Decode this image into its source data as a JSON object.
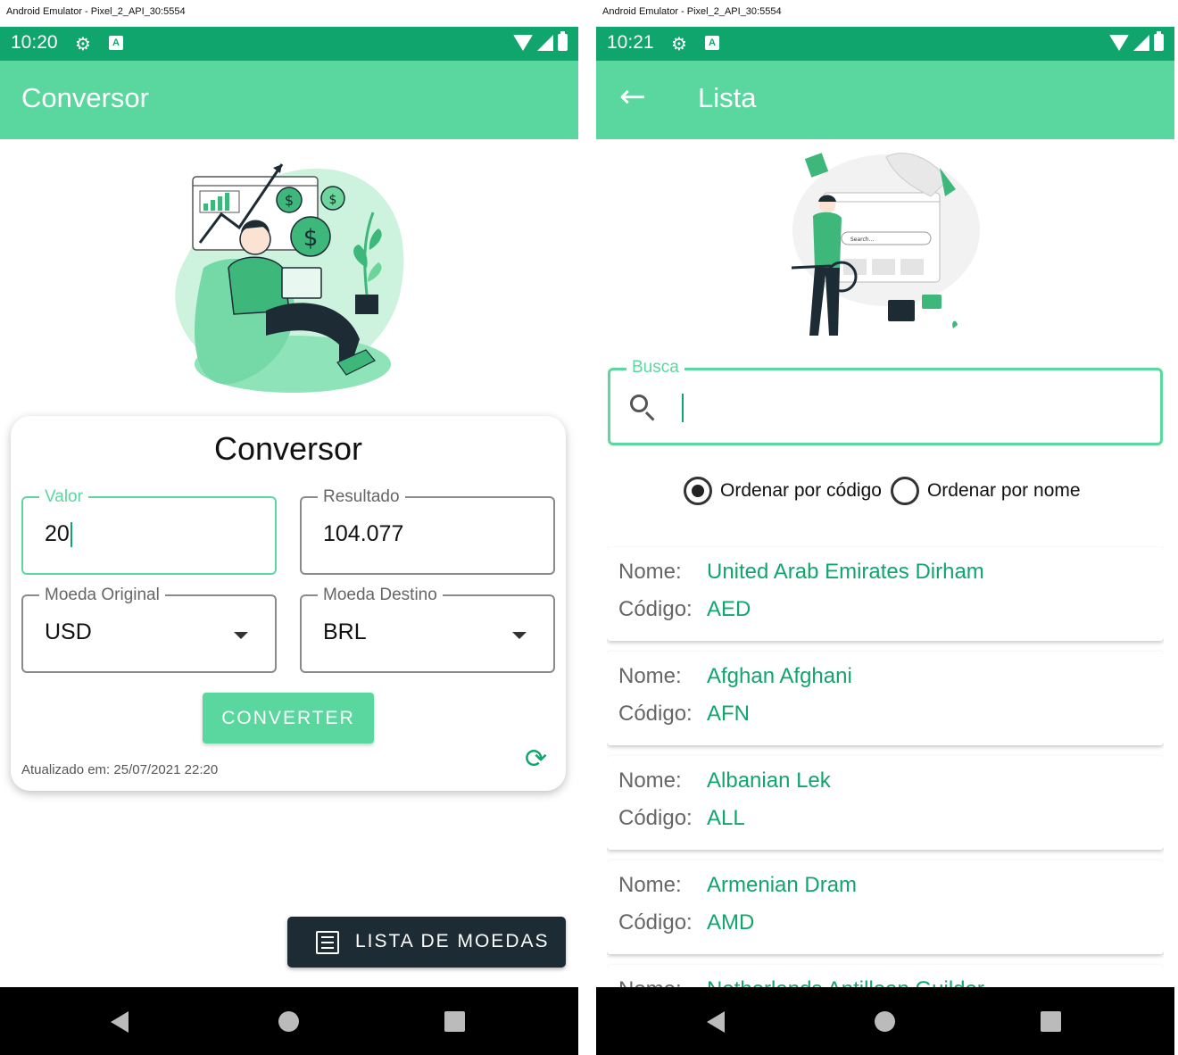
{
  "left": {
    "window_title": "Android Emulator - Pixel_2_API_30:5554",
    "status_time": "10:20",
    "appbar_title": "Conversor",
    "card_title": "Conversor",
    "valor": {
      "label": "Valor",
      "value": "20"
    },
    "resultado": {
      "label": "Resultado",
      "value": "104.077"
    },
    "moeda_original": {
      "label": "Moeda Original",
      "value": "USD"
    },
    "moeda_destino": {
      "label": "Moeda Destino",
      "value": "BRL"
    },
    "convert_label": "CONVERTER",
    "updated_text": "Atualizado em: 25/07/2021 22:20",
    "list_button_label": "LISTA DE MOEDAS"
  },
  "right": {
    "window_title": "Android Emulator - Pixel_2_API_30:5554",
    "status_time": "10:21",
    "appbar_title": "Lista",
    "search_label": "Busca",
    "search_value": "",
    "sort_options": [
      "Ordenar por código",
      "Ordenar por nome"
    ],
    "sort_selected": "Ordenar por código",
    "name_label": "Nome:",
    "code_label": "Código:",
    "currencies": [
      {
        "name": "United Arab Emirates Dirham",
        "code": "AED"
      },
      {
        "name": "Afghan Afghani",
        "code": "AFN"
      },
      {
        "name": "Albanian Lek",
        "code": "ALL"
      },
      {
        "name": "Armenian Dram",
        "code": "AMD"
      },
      {
        "name": "Netherlands Antillean Guilder",
        "code": ""
      }
    ]
  },
  "colors": {
    "status_bar": "#11a56e",
    "app_bar": "#59d79e",
    "accent_text": "#11a56e",
    "dark_button": "#1d2b34"
  },
  "icons": {
    "status": [
      "gear-icon",
      "notification-a-icon",
      "wifi-icon",
      "signal-icon",
      "battery-icon"
    ],
    "nav": [
      "back-triangle-icon",
      "home-circle-icon",
      "recents-square-icon"
    ],
    "refresh": "refresh-icon",
    "list": "list-icon",
    "search": "search-icon",
    "back": "arrow-back-icon"
  }
}
